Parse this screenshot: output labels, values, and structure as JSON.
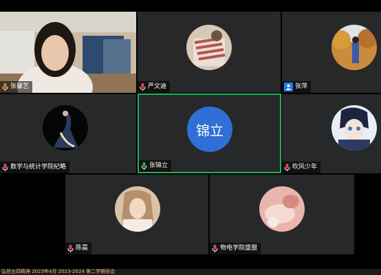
{
  "participants": [
    {
      "name": "张馨艺",
      "mic_color": "#e67e22"
    },
    {
      "name": "严文迪"
    },
    {
      "name": "张萍"
    },
    {
      "name": "数学与统计学院纪略"
    },
    {
      "name": "张锦立",
      "avatar_text": "锦立"
    },
    {
      "name": "吹风少年"
    },
    {
      "name": "陈晨"
    },
    {
      "name": "物电学院盛盟"
    }
  ],
  "bottom_text": "弘扬五四精神 2023年4月 2023-2024 第二学期班会",
  "colors": {
    "active_border": "#1fb45a",
    "tile_bg": "#272829",
    "text_avatar_bg": "#2f6fd6"
  },
  "icons": [
    "mic-icon",
    "person-icon"
  ]
}
